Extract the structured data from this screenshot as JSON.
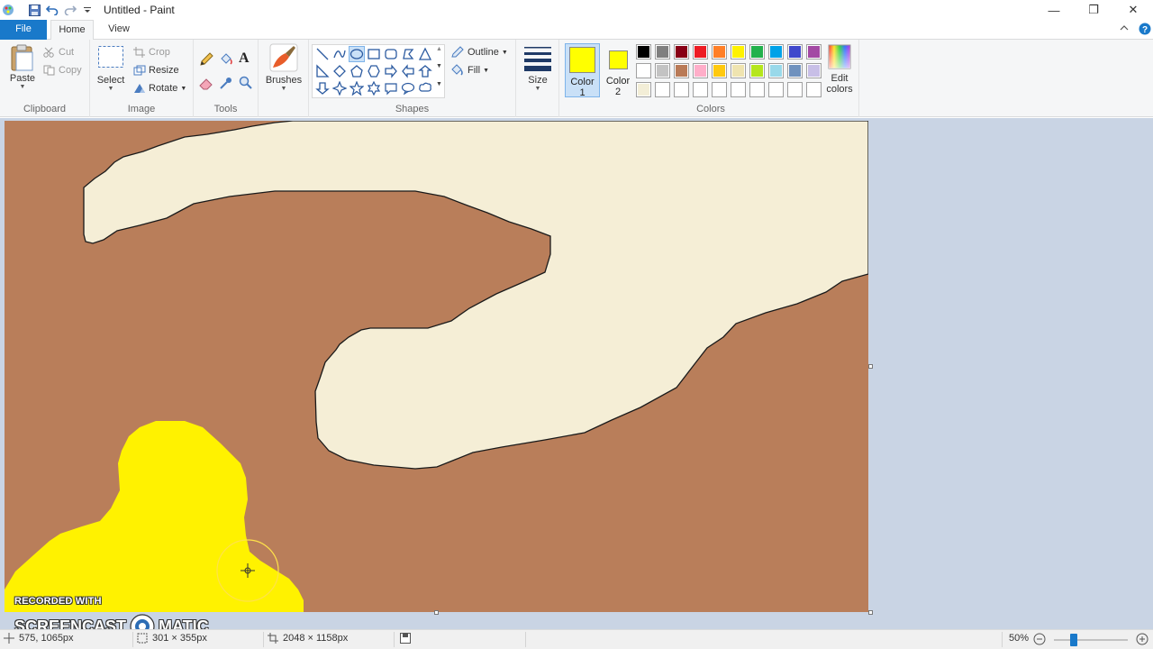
{
  "window": {
    "title": "Untitled - Paint",
    "minimize_glyph": "—",
    "restore_glyph": "❐",
    "close_glyph": "✕"
  },
  "tabs": [
    {
      "label": "File"
    },
    {
      "label": "Home"
    },
    {
      "label": "View"
    }
  ],
  "ribbon": {
    "clipboard": {
      "group_label": "Clipboard",
      "paste": "Paste",
      "cut": "Cut",
      "copy": "Copy"
    },
    "image": {
      "group_label": "Image",
      "select": "Select",
      "crop": "Crop",
      "resize": "Resize",
      "rotate": "Rotate"
    },
    "tools": {
      "group_label": "Tools",
      "text_tool_glyph": "A"
    },
    "brushes": {
      "label": "Brushes"
    },
    "shapes": {
      "group_label": "Shapes",
      "outline": "Outline",
      "fill": "Fill"
    },
    "size": {
      "label": "Size"
    },
    "color1": {
      "label_line1": "Color",
      "label_line2": "1",
      "value": "#ffff00"
    },
    "color2": {
      "label_line1": "Color",
      "label_line2": "2",
      "value": "#ffff00"
    },
    "colors": {
      "group_label": "Colors",
      "edit_line1": "Edit",
      "edit_line2": "colors",
      "row1": [
        "#000000",
        "#7f7f7f",
        "#880015",
        "#ed1c24",
        "#ff7f27",
        "#fff200",
        "#22b14c",
        "#00a2e8",
        "#3f48cc",
        "#a349a4"
      ],
      "row2": [
        "#ffffff",
        "#c3c3c3",
        "#b97a57",
        "#ffaec9",
        "#ffc90e",
        "#efe4b0",
        "#b5e61d",
        "#99d9ea",
        "#7092be",
        "#c8bfe7"
      ],
      "row3": [
        "#f3eed7",
        "#ffffff",
        "#ffffff",
        "#ffffff",
        "#ffffff",
        "#ffffff",
        "#ffffff",
        "#ffffff",
        "#ffffff",
        "#ffffff"
      ]
    }
  },
  "canvas": {
    "background_color": "#b97e5a",
    "cream_color": "#f5eed6",
    "yellow_color": "#fff200"
  },
  "watermark": {
    "line1": "RECORDED WITH",
    "left_word": "SCREENCAST",
    "right_word": "MATIC"
  },
  "status": {
    "cursor_position": "575, 1065px",
    "selection_size": "301 × 355px",
    "image_size": "2048 × 1158px",
    "zoom": "50%",
    "zoom_level": 0.5
  }
}
